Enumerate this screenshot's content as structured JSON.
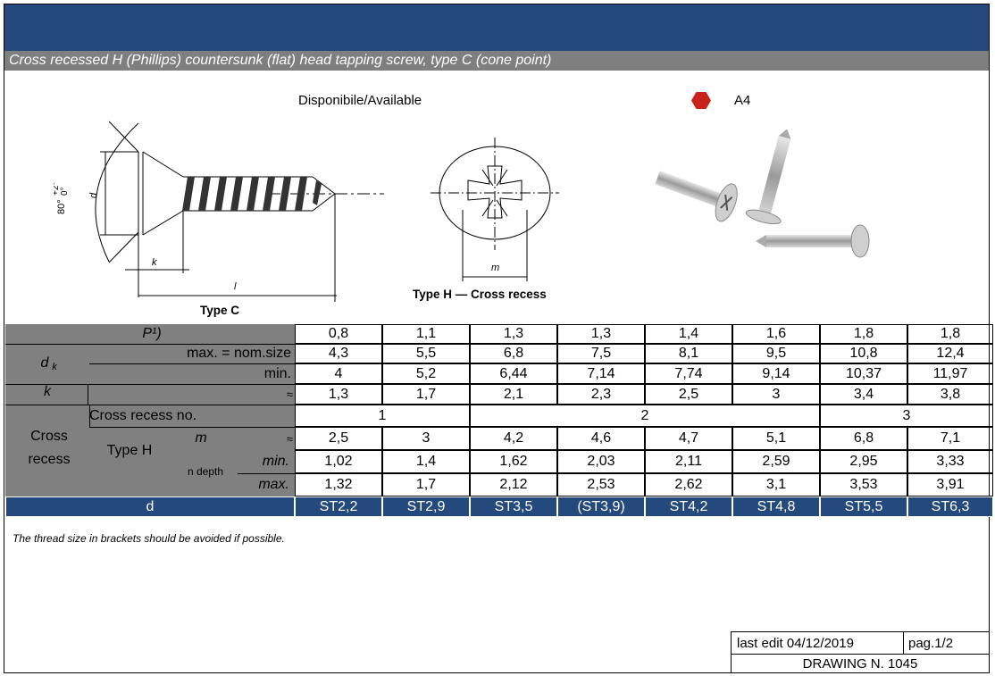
{
  "header": {
    "subtitle": "Cross recessed H (Phillips) countersunk (flat) head tapping screw, type C (cone point)"
  },
  "availability": {
    "label": "Disponibile/Available",
    "material": "A4",
    "material_color": "#c8221c"
  },
  "drawing": {
    "type_c_caption": "Type C",
    "type_h_caption": "Type H — Cross recess",
    "angle_label": "80°",
    "tol_plus": "+2°",
    "tol_zero": "0°",
    "dk_label": "d",
    "dk_sub": "k",
    "k_label": "k",
    "l_label": "l",
    "m_label": "m"
  },
  "table": {
    "p_label": "P¹)",
    "p_values": [
      "0,8",
      "1,1",
      "1,3",
      "1,3",
      "1,4",
      "1,6",
      "1,8",
      "1,8"
    ],
    "dk_label": "d",
    "dk_sub": "k",
    "dk_max_label": "max. = nom.size",
    "dk_max": [
      "4,3",
      "5,5",
      "6,8",
      "7,5",
      "8,1",
      "9,5",
      "10,8",
      "12,4"
    ],
    "dk_min_label": "min.",
    "dk_min": [
      "4",
      "5,2",
      "6,44",
      "7,14",
      "7,74",
      "9,14",
      "10,37",
      "11,97"
    ],
    "k_label": "k",
    "approx": "≈",
    "k_values": [
      "1,3",
      "1,7",
      "2,1",
      "2,3",
      "2,5",
      "3",
      "3,4",
      "3,8"
    ],
    "recess_no_label": "Cross recess no.",
    "recess_no": [
      "1",
      "2",
      "3"
    ],
    "cross_label_1": "Cross",
    "cross_label_2": "recess",
    "type_h_label": "Type H",
    "m_label": "m",
    "m_values": [
      "2,5",
      "3",
      "4,2",
      "4,6",
      "4,7",
      "5,1",
      "6,8",
      "7,1"
    ],
    "depth_label": "n depth",
    "depth_min_label": "min.",
    "depth_min": [
      "1,02",
      "1,4",
      "1,62",
      "2,03",
      "2,11",
      "2,59",
      "2,95",
      "3,33"
    ],
    "depth_max_label": "max.",
    "depth_max": [
      "1,32",
      "1,7",
      "2,12",
      "2,53",
      "2,62",
      "3,1",
      "3,53",
      "3,91"
    ],
    "d_label": "d",
    "d_values": [
      "ST2,2",
      "ST2,9",
      "ST3,5",
      "(ST3,9)",
      "ST4,2",
      "ST4,8",
      "ST5,5",
      "ST6,3"
    ]
  },
  "note": "The thread size in brackets should be avoided if possible.",
  "footer": {
    "last_edit": "last edit 04/12/2019",
    "page": "pag.1/2",
    "drawing_no": "DRAWING N. 1045"
  },
  "colors": {
    "header_blue": "#23497d",
    "grey": "#808080"
  }
}
